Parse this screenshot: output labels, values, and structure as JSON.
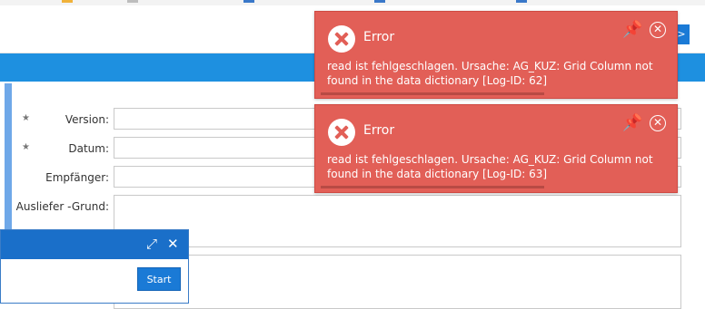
{
  "form": {
    "rows": [
      {
        "label": "Version:",
        "required": true
      },
      {
        "label": "Datum:",
        "required": true
      },
      {
        "label": "Empfänger:",
        "required": false
      },
      {
        "label": "Ausliefer -Grund:",
        "required": false
      }
    ],
    "required_marker": "★"
  },
  "panel": {
    "expand_icon": "⤢",
    "close_icon": "✕",
    "start_label": "Start"
  },
  "corner": {
    "label": ">"
  },
  "toasts": [
    {
      "title": "Error",
      "message": "read ist fehlgeschlagen. Ursache: AG_KUZ: Grid Column not found in the data dictionary [Log-ID: 62]",
      "pin_icon": "📌",
      "close_icon": "✕",
      "progress": 0.66
    },
    {
      "title": "Error",
      "message": "read ist fehlgeschlagen. Ursache: AG_KUZ: Grid Column not found in the data dictionary [Log-ID: 63]",
      "pin_icon": "📌",
      "close_icon": "✕",
      "progress": 0.66
    }
  ],
  "colors": {
    "accent_blue": "#1e90e0",
    "error_red": "#e25f57"
  }
}
